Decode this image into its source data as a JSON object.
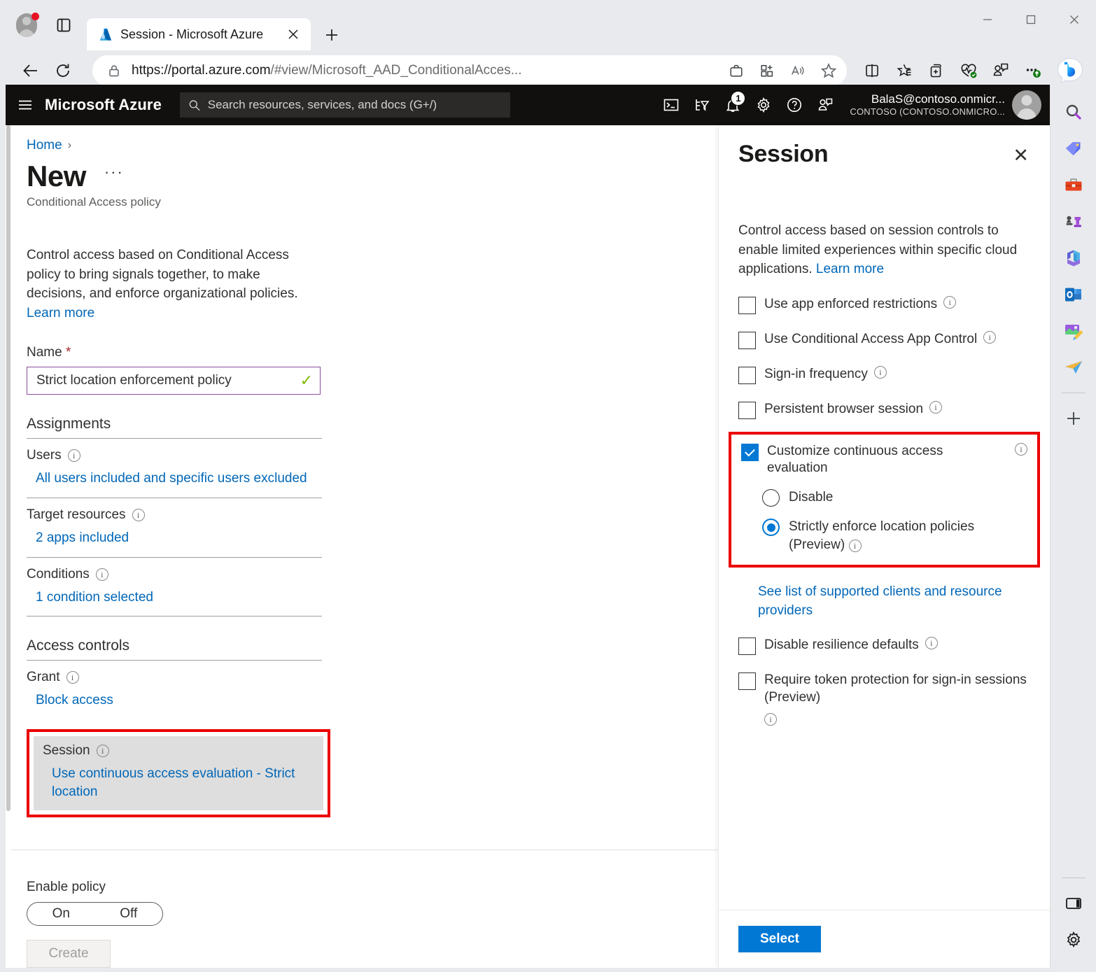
{
  "browser": {
    "tab": {
      "title": "Session - Microsoft Azure",
      "favicon": "azure-logo-icon",
      "close": "×"
    },
    "new_tab_label": "+",
    "window_controls": {
      "minimize": "—",
      "maximize": "□",
      "close": "✕"
    },
    "url_scheme": "https://portal.azure.com",
    "url_path": "/#view/Microsoft_AAD_ConditionalAcces...",
    "icons": {
      "back": "back-arrow-icon",
      "refresh": "refresh-icon",
      "lock": "lock-icon",
      "collections_bag": "shopping-bag-icon",
      "split_add": "add-to-grid-icon",
      "read_aloud": "read-aloud-icon",
      "favorite": "star-icon",
      "split_screen": "split-screen-icon",
      "favorites_list": "favorites-icon",
      "collections": "collections-icon",
      "browser_essentials": "browser-essentials-icon",
      "profile_chat": "chat-icon",
      "settings_more": "more-options-icon",
      "copilot": "bing-copilot-icon"
    }
  },
  "azure_header": {
    "brand": "Microsoft Azure",
    "menu_icon": "hamburger-menu-icon",
    "search": {
      "placeholder": "Search resources, services, and docs (G+/)",
      "value": "",
      "icon": "search-icon"
    },
    "icons": [
      {
        "name": "cloud-shell-icon"
      },
      {
        "name": "directories-subscriptions-icon"
      },
      {
        "name": "notifications-icon",
        "badge": "1"
      },
      {
        "name": "settings-gear-icon"
      },
      {
        "name": "help-icon"
      },
      {
        "name": "feedback-icon"
      }
    ],
    "account": {
      "name": "BalaS@contoso.onmicr...",
      "org": "CONTOSO (CONTOSO.ONMICRO..."
    }
  },
  "blade": {
    "breadcrumb": {
      "home": "Home",
      "separator": "›"
    },
    "title": "New",
    "ellipsis": "···",
    "subtitle": "Conditional Access policy",
    "description": "Control access based on Conditional Access policy to bring signals together, to make decisions, and enforce organizational policies.",
    "learn_more": "Learn more",
    "name_field": {
      "label": "Name",
      "required_marker": "*",
      "value": "Strict location enforcement policy",
      "valid_icon": "✓"
    },
    "assignments": {
      "heading": "Assignments",
      "rows": [
        {
          "label": "Users",
          "value": "All users included and specific users excluded"
        },
        {
          "label": "Target resources",
          "value": "2 apps included"
        },
        {
          "label": "Conditions",
          "value": "1 condition selected"
        }
      ]
    },
    "access_controls": {
      "heading": "Access controls",
      "grant": {
        "label": "Grant",
        "value": "Block access"
      },
      "session": {
        "label": "Session",
        "value": "Use continuous access evaluation - Strict location",
        "highlighted": true
      }
    },
    "enable_policy": {
      "label": "Enable policy",
      "on": "On",
      "off": "Off",
      "selected": "On"
    },
    "create_button": "Create"
  },
  "pane": {
    "title": "Session",
    "close_icon": "✕",
    "description": "Control access based on session controls to enable limited experiences within specific cloud applications.",
    "learn_more": "Learn more",
    "options": [
      {
        "label": "Use app enforced restrictions",
        "checked": false,
        "info": true
      },
      {
        "label": "Use Conditional Access App Control",
        "checked": false,
        "info": true
      },
      {
        "label": "Sign-in frequency",
        "checked": false,
        "info": true
      },
      {
        "label": "Persistent browser session",
        "checked": false,
        "info": true
      }
    ],
    "cae": {
      "label": "Customize continuous access evaluation",
      "checked": true,
      "info": true,
      "highlighted": true,
      "radios": [
        {
          "label": "Disable",
          "selected": false,
          "info": false
        },
        {
          "label": "Strictly enforce location policies (Preview)",
          "selected": true,
          "info": true
        }
      ]
    },
    "supported_link": "See list of supported clients and resource providers",
    "options_after": [
      {
        "label": "Disable resilience defaults",
        "checked": false,
        "info": true
      },
      {
        "label": "Require token protection for sign-in sessions (Preview)",
        "checked": false,
        "info": true
      }
    ],
    "select_button": "Select"
  },
  "edge_sidebar": {
    "items": [
      {
        "name": "search-icon"
      },
      {
        "name": "shopping-tag-icon"
      },
      {
        "name": "tools-briefcase-icon"
      },
      {
        "name": "games-chess-icon"
      },
      {
        "name": "microsoft-365-icon"
      },
      {
        "name": "outlook-icon"
      },
      {
        "name": "image-creator-icon"
      },
      {
        "name": "drop-send-icon"
      }
    ],
    "add_label": "+",
    "bottom": [
      {
        "name": "sidebar-panel-icon"
      },
      {
        "name": "sidebar-settings-icon"
      }
    ]
  },
  "colors": {
    "azure_blue": "#0078d4",
    "link_blue": "#0067b8",
    "highlight_red": "#ec0000",
    "nav_black": "#12100e",
    "session_bg": "#dedede",
    "input_border": "#8a4f9e",
    "valid_green": "#7fba00"
  }
}
